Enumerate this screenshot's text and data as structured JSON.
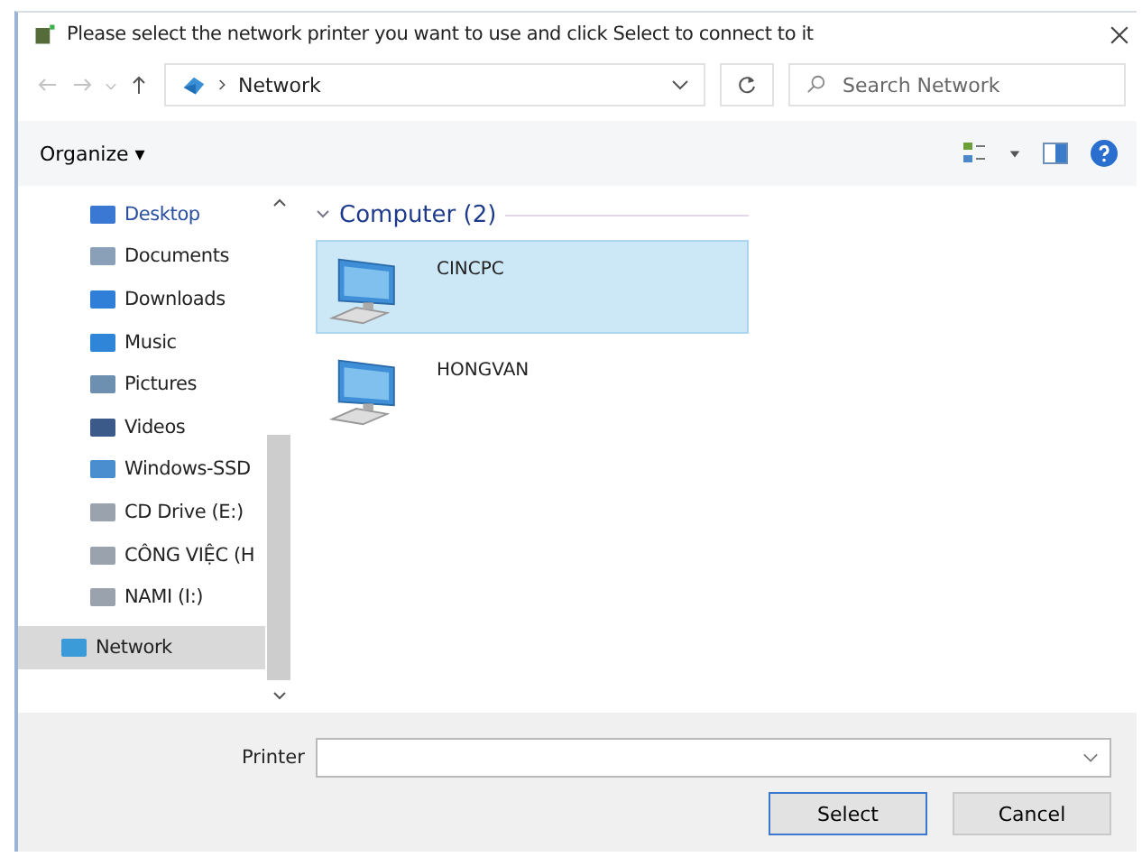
{
  "window": {
    "title": "Please select the network printer you want to use and click Select to connect to it"
  },
  "address_bar": {
    "location": "Network"
  },
  "search": {
    "placeholder": "Search Network"
  },
  "toolbar": {
    "organize": "Organize ▾"
  },
  "sidebar": {
    "items": [
      {
        "label": "Desktop",
        "selected": false
      },
      {
        "label": "Documents",
        "selected": false
      },
      {
        "label": "Downloads",
        "selected": false
      },
      {
        "label": "Music",
        "selected": false
      },
      {
        "label": "Pictures",
        "selected": false
      },
      {
        "label": "Videos",
        "selected": false
      },
      {
        "label": "Windows-SSD",
        "selected": false
      },
      {
        "label": "CD Drive (E:)",
        "selected": false
      },
      {
        "label": "CÔNG VIỆC (H",
        "selected": false
      },
      {
        "label": "NAMI (I:)",
        "selected": false
      },
      {
        "label": "Network",
        "selected": true
      }
    ]
  },
  "group": {
    "title": "Computer (2)",
    "expanded": true,
    "items": [
      {
        "name": "CINCPC",
        "selected": true
      },
      {
        "name": "HONGVAN",
        "selected": false
      }
    ]
  },
  "printer_field": {
    "label": "Printer"
  },
  "buttons": [
    {
      "label": "Select",
      "default": true
    },
    {
      "label": "Cancel",
      "default": false
    }
  ]
}
